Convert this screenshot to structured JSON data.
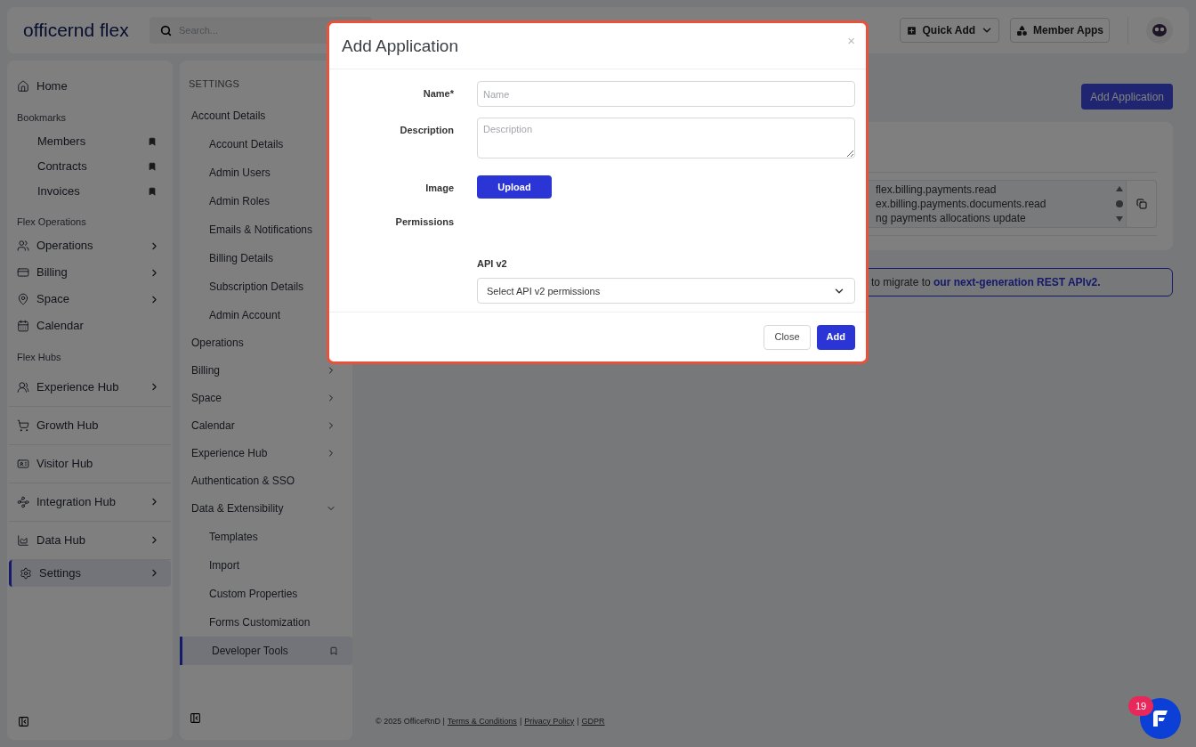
{
  "header": {
    "logo": "officernd flex",
    "search_placeholder": "Search...",
    "quick_add": "Quick Add",
    "member_apps": "Member Apps"
  },
  "nav": [
    {
      "kind": "link",
      "label": "Home",
      "chevron": false,
      "selected": false
    },
    {
      "kind": "heading",
      "label": "Bookmarks"
    },
    {
      "kind": "bookmark",
      "label": "Members"
    },
    {
      "kind": "bookmark",
      "label": "Contracts"
    },
    {
      "kind": "bookmark",
      "label": "Invoices"
    },
    {
      "kind": "heading",
      "label": "Flex Operations"
    },
    {
      "kind": "link",
      "label": "Operations",
      "chevron": true,
      "selected": false
    },
    {
      "kind": "link",
      "label": "Billing",
      "chevron": true,
      "selected": false
    },
    {
      "kind": "link",
      "label": "Space",
      "chevron": true,
      "selected": false
    },
    {
      "kind": "link",
      "label": "Calendar",
      "chevron": false,
      "selected": false
    },
    {
      "kind": "heading",
      "label": "Flex Hubs"
    },
    {
      "kind": "hub",
      "label": "Experience Hub",
      "chevron": true,
      "selected": false
    },
    {
      "kind": "hub",
      "label": "Growth Hub",
      "chevron": false,
      "selected": false
    },
    {
      "kind": "hub",
      "label": "Visitor Hub",
      "chevron": false,
      "selected": false
    },
    {
      "kind": "hub",
      "label": "Integration Hub",
      "chevron": true,
      "selected": false
    },
    {
      "kind": "hub",
      "label": "Data Hub",
      "chevron": true,
      "selected": false
    },
    {
      "kind": "link",
      "label": "Settings",
      "chevron": true,
      "selected": true
    }
  ],
  "settings_nav": {
    "title": "SETTINGS",
    "items": [
      {
        "label": "Account Details",
        "children": [
          {
            "label": "Account Details",
            "selected": false
          },
          {
            "label": "Admin Users",
            "selected": false
          },
          {
            "label": "Admin Roles",
            "selected": false
          },
          {
            "label": "Emails & Notifications",
            "selected": false
          },
          {
            "label": "Billing Details",
            "selected": false
          },
          {
            "label": "Subscription Details",
            "selected": false
          },
          {
            "label": "Admin Account",
            "selected": false
          }
        ]
      },
      {
        "label": "Operations"
      },
      {
        "label": "Billing",
        "expanded": false
      },
      {
        "label": "Space",
        "expanded": false
      },
      {
        "label": "Calendar",
        "expanded": false
      },
      {
        "label": "Experience Hub",
        "expanded": false
      },
      {
        "label": "Authentication & SSO"
      },
      {
        "label": "Data & Extensibility",
        "expanded": true,
        "children": [
          {
            "label": "Templates",
            "selected": false
          },
          {
            "label": "Import",
            "selected": false
          },
          {
            "label": "Custom Properties",
            "selected": false
          },
          {
            "label": "Forms Customization",
            "selected": false
          },
          {
            "label": "Developer Tools",
            "selected": true
          }
        ]
      }
    ]
  },
  "main": {
    "add_button": "Add Application",
    "permission_lines": [
      "flex.billing.payments.read",
      "ex.billing.payments.documents.read",
      "ng payments allocations update"
    ],
    "notice": {
      "text": "to migrate to ",
      "link": "our next-generation REST APIv2."
    }
  },
  "footer": {
    "copyright": "© 2025 OfficeRnD |",
    "links": [
      {
        "label": "Terms & Conditions",
        "separator": "|"
      },
      {
        "label": "Privacy Policy",
        "separator": "|"
      },
      {
        "label": "GDPR"
      }
    ]
  },
  "chat": {
    "badge": "19"
  },
  "modal": {
    "title": "Add Application",
    "close": "×",
    "fields": [
      {
        "kind": "input",
        "label": "Name*",
        "placeholder": "Name"
      },
      {
        "kind": "textarea",
        "label": "Description",
        "placeholder": "Description"
      },
      {
        "kind": "upload",
        "label": "Image",
        "button": "Upload"
      },
      {
        "kind": "section",
        "label": "Permissions"
      },
      {
        "kind": "select",
        "sublabel": "API v2",
        "value": "Select API v2 permissions"
      }
    ],
    "buttons": [
      {
        "label": "Close",
        "primary": false
      },
      {
        "label": "Add",
        "primary": true
      }
    ]
  }
}
